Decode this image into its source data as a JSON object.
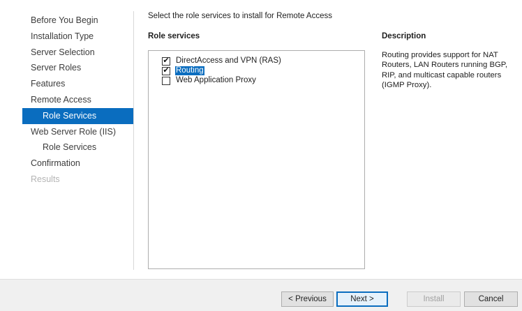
{
  "nav": {
    "items": [
      {
        "label": "Before You Begin",
        "state": "normal"
      },
      {
        "label": "Installation Type",
        "state": "normal"
      },
      {
        "label": "Server Selection",
        "state": "normal"
      },
      {
        "label": "Server Roles",
        "state": "normal"
      },
      {
        "label": "Features",
        "state": "normal"
      },
      {
        "label": "Remote Access",
        "state": "normal"
      },
      {
        "label": "Role Services",
        "state": "active"
      },
      {
        "label": "Web Server Role (IIS)",
        "state": "normal"
      },
      {
        "label": "Role Services",
        "state": "normal"
      },
      {
        "label": "Confirmation",
        "state": "normal"
      },
      {
        "label": "Results",
        "state": "disabled"
      }
    ]
  },
  "main": {
    "instruction": "Select the role services to install for Remote Access",
    "role_services_header": "Role services",
    "description_header": "Description",
    "role_services": [
      {
        "label": "DirectAccess and VPN (RAS)",
        "checked": true,
        "selected": false
      },
      {
        "label": "Routing",
        "checked": true,
        "selected": true
      },
      {
        "label": "Web Application Proxy",
        "checked": false,
        "selected": false
      }
    ],
    "description": "Routing provides support for NAT Routers, LAN Routers running BGP, RIP, and multicast capable routers (IGMP Proxy)."
  },
  "footer": {
    "previous_label": "< Previous",
    "next_label": "Next >",
    "install_label": "Install",
    "cancel_label": "Cancel"
  },
  "colors": {
    "accent": "#0a6dbf",
    "footer_bg": "#f0f0f0",
    "disabled_text": "#b4b4b4"
  }
}
